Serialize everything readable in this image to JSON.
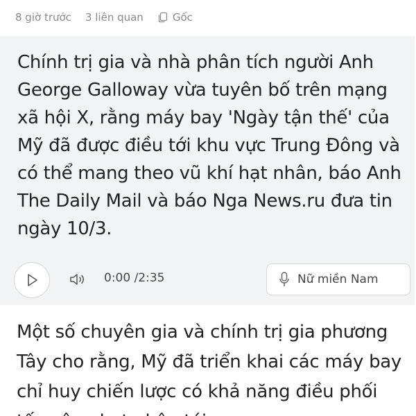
{
  "meta": {
    "time_ago": "8 giờ trước",
    "related": "3 liên quan",
    "source": "Gốc"
  },
  "sapo": {
    "text": "Chính trị gia và nhà phân tích người Anh George Galloway vừa tuyên bố trên mạng xã hội X, rằng máy bay 'Ngày tận thế' của Mỹ đã được điều tới khu vực Trung Đông và có thể mang theo vũ khí hạt nhân, báo Anh The Daily Mail và báo Nga News.ru đưa tin ngày 10/3."
  },
  "player": {
    "time": "0:00 /2:35",
    "voice": "Nữ miền Nam",
    "play_icon": "play-icon",
    "volume_icon": "volume-icon",
    "mic_icon": "mic-icon",
    "progress": 0
  },
  "article": {
    "paragraph": "Một số chuyên gia và chính trị gia phương Tây cho rằng, Mỹ đã triển khai các máy bay chỉ huy chiến lược có khả năng điều phối tấn công hạt nhân tới"
  },
  "colors": {
    "panel": "#f2f3f5",
    "muted": "#8a8a8a",
    "text": "#222222"
  }
}
